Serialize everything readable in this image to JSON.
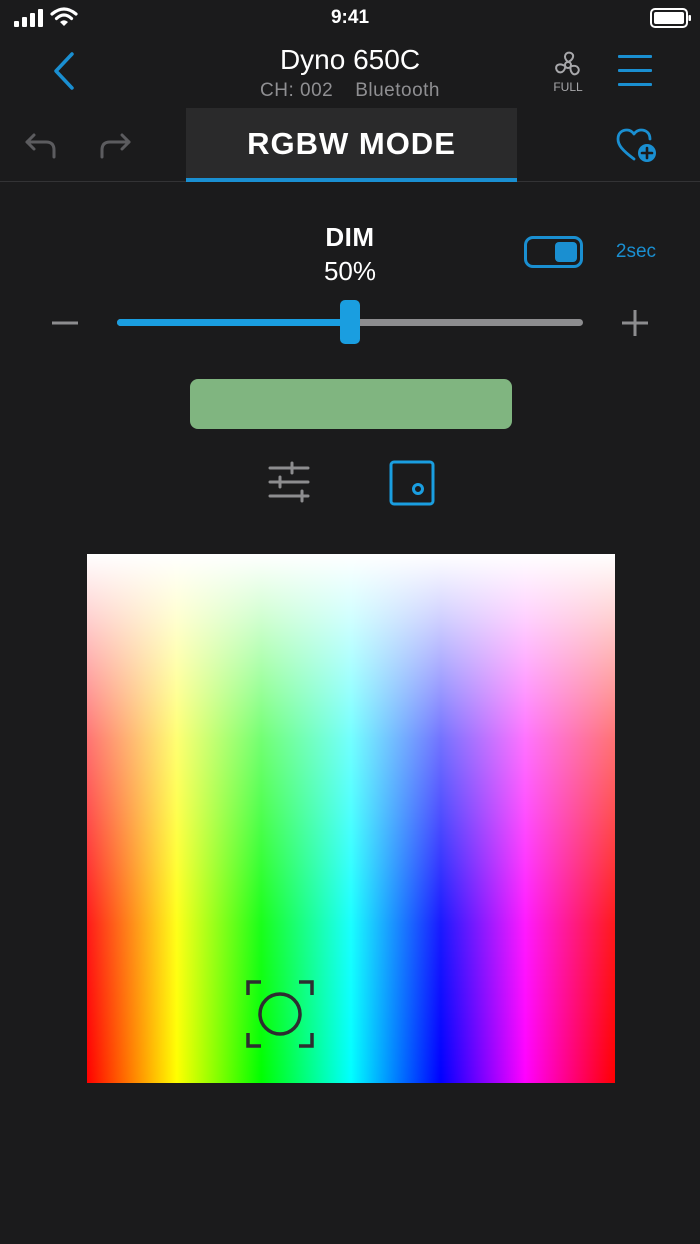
{
  "status_bar": {
    "time": "9:41"
  },
  "header": {
    "title": "Dyno 650C",
    "channel": "CH: 002",
    "connection": "Bluetooth",
    "fan_label": "FULL"
  },
  "toolbar": {
    "mode_title": "RGBW MODE"
  },
  "dim": {
    "label": "DIM",
    "value_text": "50%",
    "value": 50,
    "fade_time": "2sec",
    "fade_enabled": true
  },
  "swatch_color": "#80b580",
  "picker": {
    "cursor_hue_fraction": 0.365,
    "cursor_position_fraction": 0.87
  },
  "colors": {
    "accent": "#1a8fd1",
    "background": "#1b1b1c"
  },
  "icons": [
    "signal-icon",
    "wifi-icon",
    "battery-icon",
    "back-icon",
    "fan-icon",
    "menu-icon",
    "undo-icon",
    "redo-icon",
    "favorite-add-icon",
    "minus-icon",
    "plus-icon",
    "sliders-icon",
    "color-picker-icon"
  ]
}
